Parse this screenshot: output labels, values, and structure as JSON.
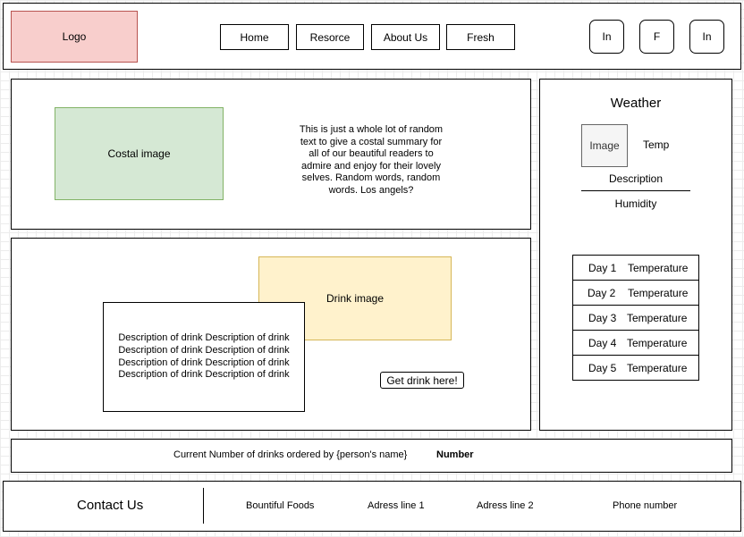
{
  "header": {
    "logo": "Logo",
    "nav": [
      "Home",
      "Resorce",
      "About Us",
      "Fresh"
    ],
    "social": [
      "In",
      "F",
      "In"
    ]
  },
  "coastal": {
    "image_label": "Costal image",
    "summary": "This is just a whole lot of random text to give a costal summary for all of our beautiful readers to admire and enjoy for their lovely selves. Random words, random words. Los angels?"
  },
  "drink": {
    "image_label": "Drink image",
    "description": "Description of drink Description of drink Description of drink Description of drink Description of drink Description of drink Description of drink Description of drink",
    "button": "Get drink here!"
  },
  "weather": {
    "title": "Weather",
    "image_label": "Image",
    "temp": "Temp",
    "description": "Description",
    "humidity": "Humidity",
    "days": [
      {
        "day": "Day 1",
        "temp": "Temperature"
      },
      {
        "day": "Day 2",
        "temp": "Temperature"
      },
      {
        "day": "Day 3",
        "temp": "Temperature"
      },
      {
        "day": "Day 4",
        "temp": "Temperature"
      },
      {
        "day": "Day 5",
        "temp": "Temperature"
      }
    ]
  },
  "orders": {
    "label": "Current Number of drinks ordered by {person's name}",
    "value": "Number"
  },
  "footer": {
    "contact": "Contact Us",
    "company": "Bountiful Foods",
    "address1": "Adress line 1",
    "address2": "Adress line 2",
    "phone": "Phone number"
  },
  "colors": {
    "logo_fill": "#f8cecc",
    "logo_border": "#b85450",
    "coastal_fill": "#d5e8d4",
    "coastal_border": "#82b366",
    "drink_fill": "#fff2cc",
    "drink_border": "#d6b656",
    "weather_image_fill": "#f5f5f5"
  }
}
